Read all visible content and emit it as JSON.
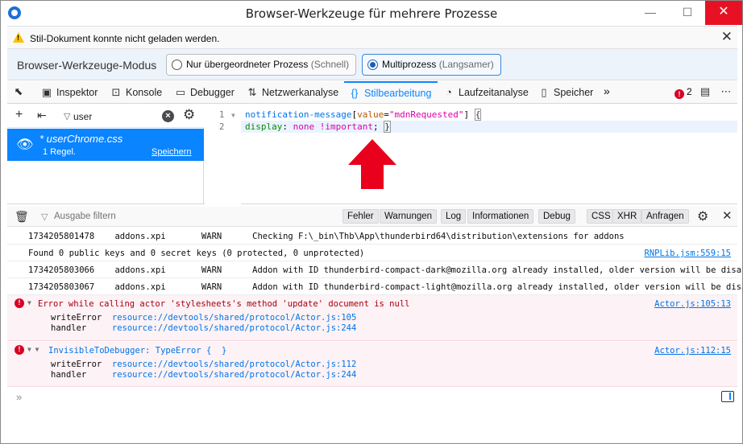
{
  "window": {
    "title": "Browser-Werkzeuge für mehrere Prozesse",
    "minimize": "—",
    "maximize": "☐",
    "close": "✕"
  },
  "notification": {
    "icon": "warning-icon",
    "text": "Stil-Dokument konnte nicht geladen werden."
  },
  "mode_bar": {
    "label": "Browser-Werkzeuge-Modus",
    "option_parent": "Nur übergeordneter Prozess",
    "option_parent_hint": "(Schnell)",
    "option_multi": "Multiprozess",
    "option_multi_hint": "(Langsamer)",
    "selected": "multi"
  },
  "toolbar": {
    "tabs": [
      {
        "label": "Inspektor",
        "icon": "inspector-icon"
      },
      {
        "label": "Konsole",
        "icon": "console-icon"
      },
      {
        "label": "Debugger",
        "icon": "debugger-icon"
      },
      {
        "label": "Netzwerkanalyse",
        "icon": "network-icon"
      },
      {
        "label": "Stilbearbeitung",
        "icon": "style-editor-icon",
        "active": true
      },
      {
        "label": "Laufzeitanalyse",
        "icon": "performance-icon"
      },
      {
        "label": "Speicher",
        "icon": "memory-icon"
      }
    ],
    "error_count": "2",
    "accent": "#0a84ff"
  },
  "style_editor": {
    "filter_value": "user",
    "sheet": {
      "name": "* userChrome.css",
      "rules": "1 Regel.",
      "save": "Speichern"
    },
    "lines": [
      {
        "number": "1",
        "selector": "notification-message",
        "bracket_open": "[",
        "attr": "value",
        "eq": "=",
        "string": "\"mdnRequested\"",
        "bracket_close": "]",
        "brace": "{"
      },
      {
        "number": "2",
        "property": "display",
        "colon": ":",
        "value": "none !important",
        "semi": ";",
        "brace": "}"
      }
    ]
  },
  "console": {
    "filter_placeholder": "Ausgabe filtern",
    "filters": [
      "Fehler",
      "Warnungen",
      "Log",
      "Informationen",
      "Debug"
    ],
    "filters_net": [
      "CSS",
      "XHR",
      "Anfragen"
    ],
    "messages": [
      {
        "text": "1734205801478    addons.xpi       WARN      Checking F:\\_bin\\Thb\\App\\thunderbird64\\distribution\\extensions for addons",
        "src": ""
      },
      {
        "text": "Found 0 public keys and 0 secret keys (0 protected, 0 unprotected)",
        "src": "RNPLib.jsm:559:15"
      },
      {
        "text": "1734205803066    addons.xpi       WARN      Addon with ID thunderbird-compact-dark@mozilla.org already installed, older version will be disabled",
        "src": ""
      },
      {
        "text": "1734205803067    addons.xpi       WARN      Addon with ID thunderbird-compact-light@mozilla.org already installed, older version will be disabled",
        "src": ""
      }
    ],
    "errors": [
      {
        "title": "Error while calling actor 'stylesheets's method 'update' document is null",
        "src": "Actor.js:105:13",
        "stack": [
          {
            "fn": "writeError",
            "loc": "resource://devtools/shared/protocol/Actor.js:105"
          },
          {
            "fn": "handler",
            "loc": "resource://devtools/shared/protocol/Actor.js:244"
          }
        ]
      },
      {
        "title_type": "InvisibleToDebugger:",
        "title_rest": "TypeError {  }",
        "src": "Actor.js:112:15",
        "stack": [
          {
            "fn": "writeError",
            "loc": "resource://devtools/shared/protocol/Actor.js:112"
          },
          {
            "fn": "handler",
            "loc": "resource://devtools/shared/protocol/Actor.js:244"
          }
        ]
      }
    ],
    "prompt": "»"
  }
}
